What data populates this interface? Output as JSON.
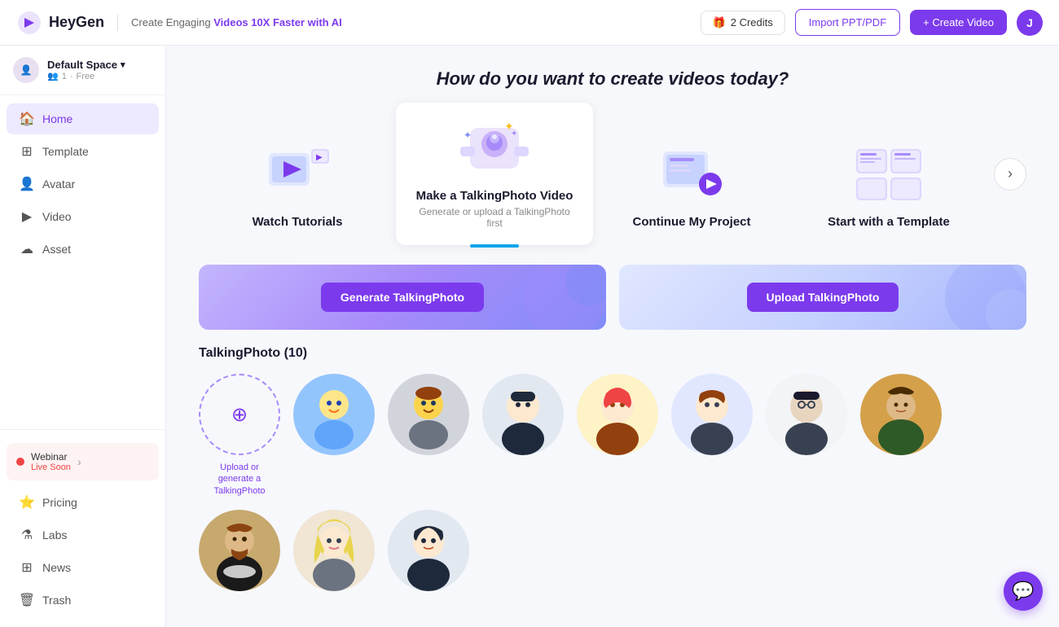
{
  "header": {
    "logo": "HeyGen",
    "tagline_prefix": "Create Engaging ",
    "tagline_highlight": "Videos 10X Faster with AI",
    "credits_label": "2 Credits",
    "import_label": "Import PPT/PDF",
    "create_label": "+ Create Video",
    "user_initial": "J"
  },
  "sidebar": {
    "workspace_name": "Default Space",
    "workspace_members": "1",
    "workspace_plan": "Free",
    "nav_items": [
      {
        "id": "home",
        "label": "Home",
        "icon": "🏠",
        "active": true
      },
      {
        "id": "template",
        "label": "Template",
        "icon": "⊞"
      },
      {
        "id": "avatar",
        "label": "Avatar",
        "icon": "👤"
      },
      {
        "id": "video",
        "label": "Video",
        "icon": "▶"
      },
      {
        "id": "asset",
        "label": "Asset",
        "icon": "☁"
      }
    ],
    "bottom_items": [
      {
        "id": "pricing",
        "label": "Pricing",
        "icon": "⭐"
      },
      {
        "id": "labs",
        "label": "Labs",
        "icon": "⚗"
      },
      {
        "id": "news",
        "label": "News",
        "icon": "⊞"
      },
      {
        "id": "trash",
        "label": "Trash",
        "icon": "🗑"
      }
    ],
    "webinar_label": "Webinar",
    "webinar_sub": "Live Soon",
    "webinar_chevron": "›"
  },
  "main": {
    "heading": "How do you want to create videos today?",
    "cards": [
      {
        "id": "tutorials",
        "title": "Watch Tutorials",
        "sub": ""
      },
      {
        "id": "talkingphoto",
        "title": "Make a TalkingPhoto Video",
        "sub": "Generate or upload a TalkingPhoto first",
        "active": true
      },
      {
        "id": "continue",
        "title": "Continue My Project",
        "sub": ""
      },
      {
        "id": "template",
        "title": "Start with a Template",
        "sub": ""
      }
    ],
    "next_btn": "›",
    "generate_btn": "Generate TalkingPhoto",
    "upload_btn": "Upload TalkingPhoto",
    "section_title": "TalkingPhoto (10)",
    "add_label": "Upload or\ngenerate a\nTalkingPhoto",
    "photos": [
      {
        "id": "photo1",
        "color": "av1"
      },
      {
        "id": "photo2",
        "color": "av2"
      },
      {
        "id": "photo3",
        "color": "av3"
      },
      {
        "id": "photo4",
        "color": "av4"
      },
      {
        "id": "photo5",
        "color": "av5"
      },
      {
        "id": "photo6",
        "color": "av6"
      },
      {
        "id": "photo7",
        "color": "av7"
      },
      {
        "id": "photo8",
        "color": "av8"
      },
      {
        "id": "photo9",
        "color": "av9"
      },
      {
        "id": "photo10",
        "color": "av10"
      },
      {
        "id": "photo11",
        "color": "av11"
      },
      {
        "id": "photo12",
        "color": "av12"
      },
      {
        "id": "photo13",
        "color": "av13"
      },
      {
        "id": "photo14",
        "color": "av14"
      }
    ]
  }
}
